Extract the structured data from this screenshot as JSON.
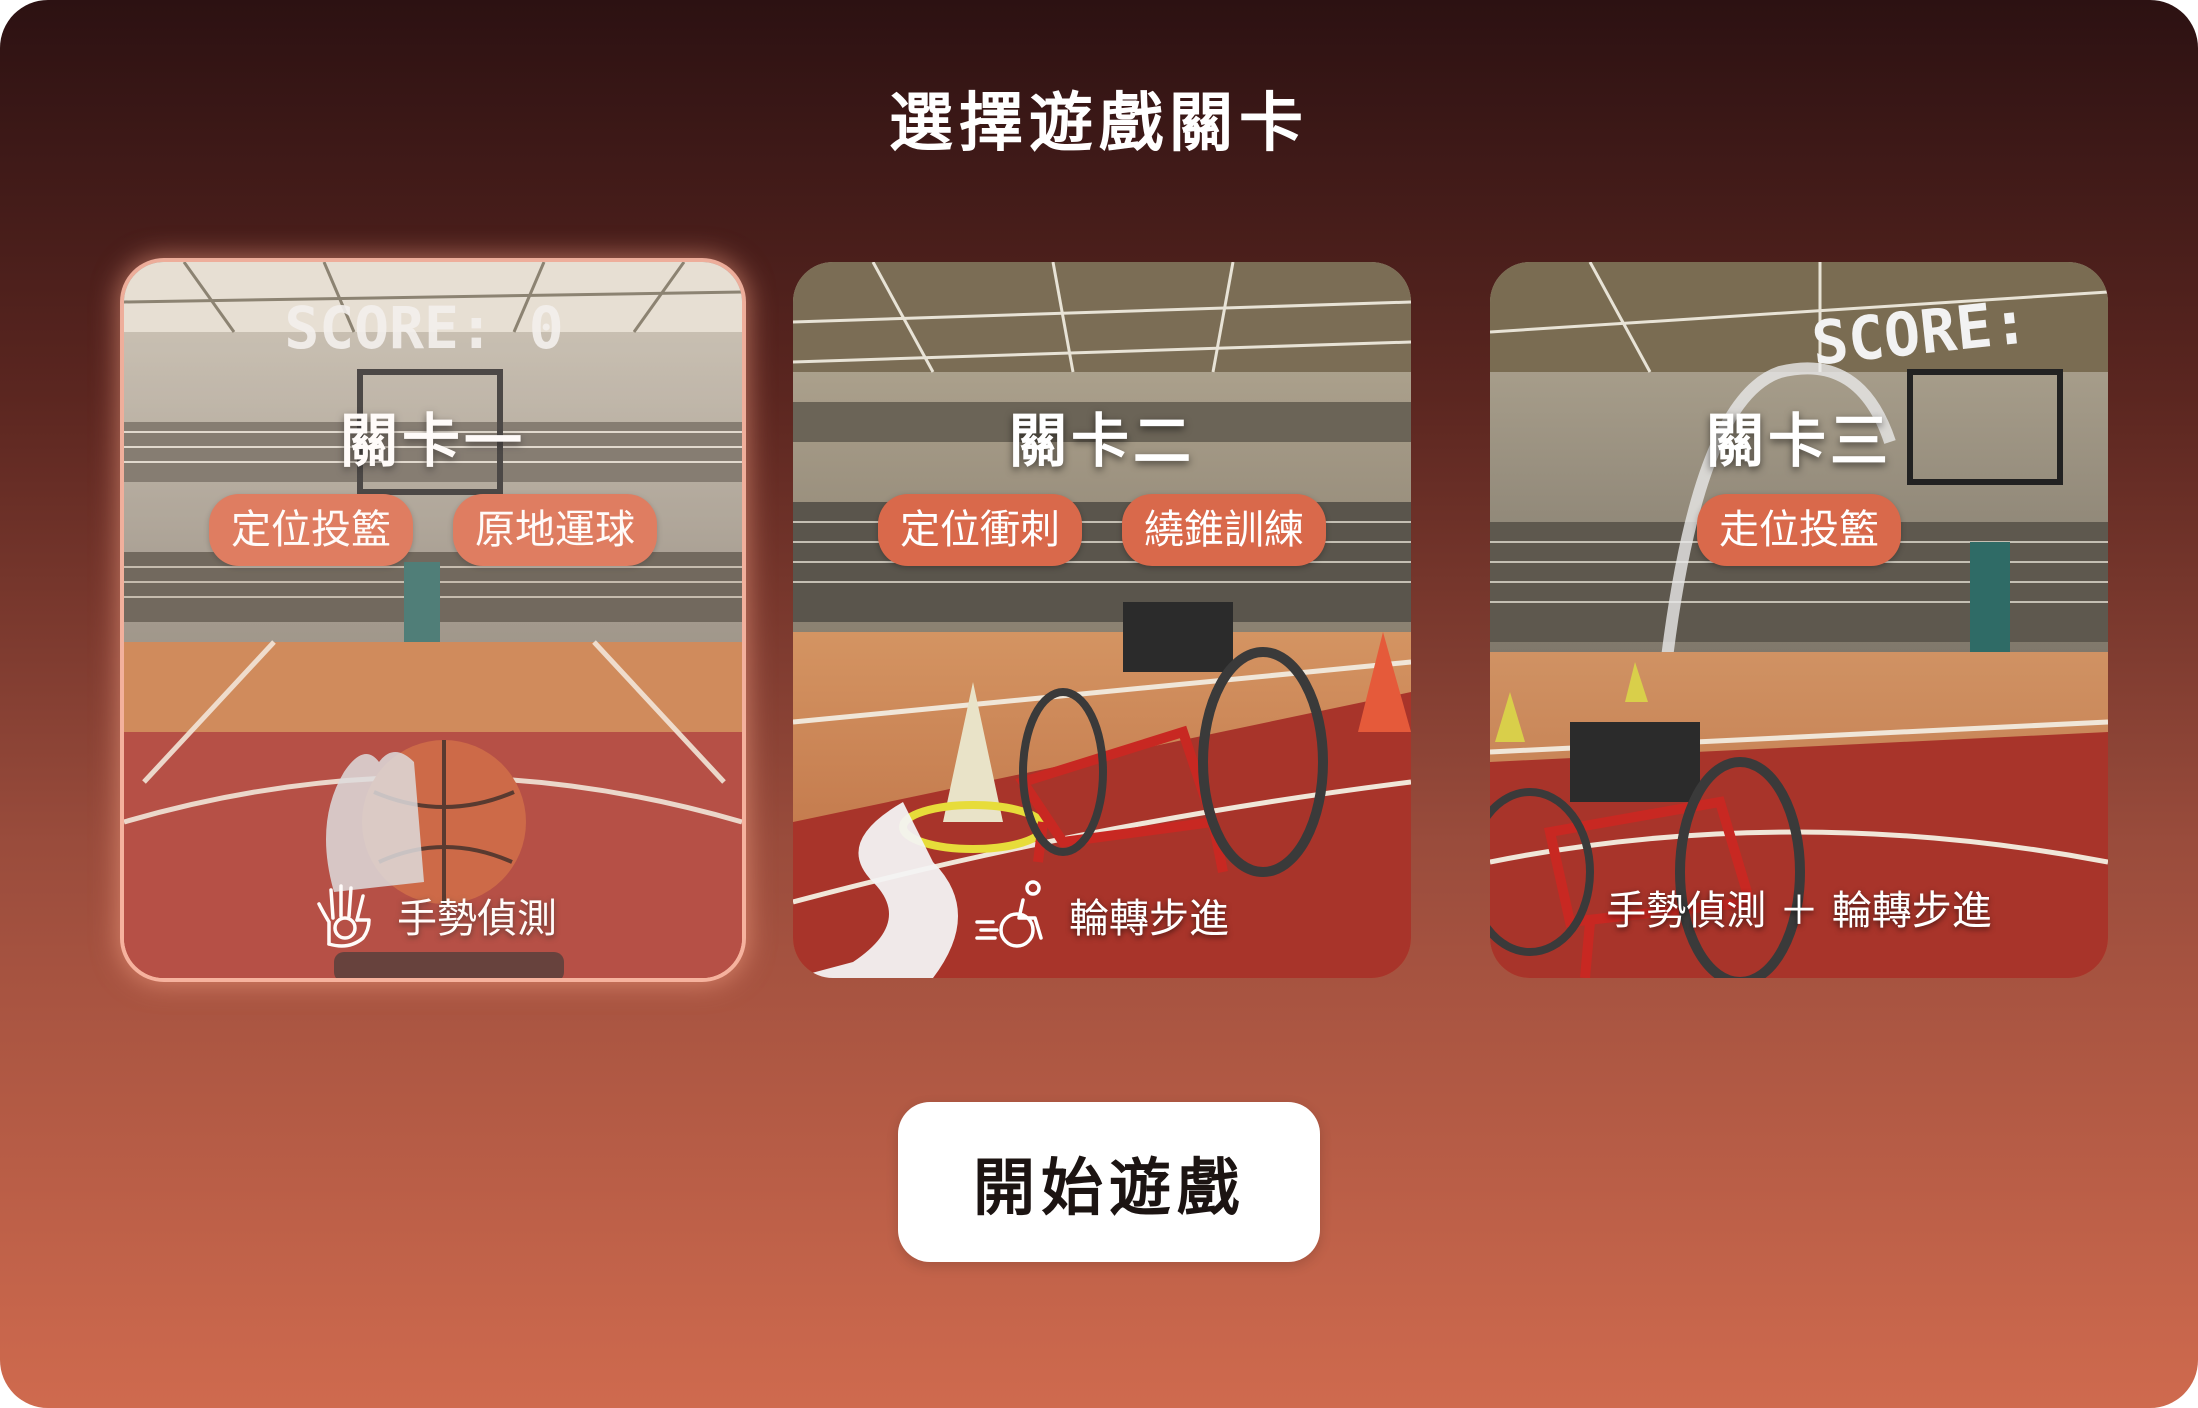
{
  "page": {
    "title": "選擇遊戲關卡",
    "start_label": "開始遊戲"
  },
  "levels": [
    {
      "name": "關卡一",
      "tags": [
        "定位投籃",
        "原地運球"
      ],
      "mode_icon": "hand-gesture-icon",
      "mode_label": "手勢偵測",
      "score_text": "SCORE: 0",
      "selected": true
    },
    {
      "name": "關卡二",
      "tags": [
        "定位衝刺",
        "繞錐訓練"
      ],
      "mode_icon": "wheelchair-icon",
      "mode_label": "輪轉步進",
      "selected": false
    },
    {
      "name": "關卡三",
      "tags": [
        "走位投籃"
      ],
      "mode_label": "手勢偵測 ＋ 輪轉步進",
      "score_text": "SCORE:",
      "selected": false
    }
  ],
  "colors": {
    "tag_bg": "#d9694b",
    "court_red": "#a8342a",
    "start_button_bg": "#ffffff"
  }
}
